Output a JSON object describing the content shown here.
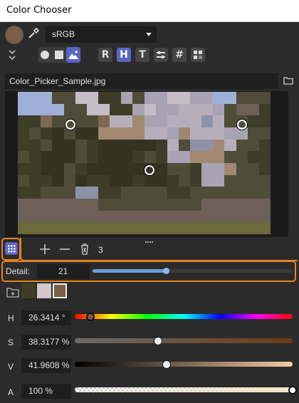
{
  "window": {
    "title": "Color Chooser"
  },
  "toolbar": {
    "color_space": "sRGB",
    "mode_buttons": [
      "circle",
      "square",
      "image"
    ],
    "tab_buttons": [
      "R",
      "H",
      "T",
      "⠒",
      "#",
      "▚"
    ],
    "active_tab": "H"
  },
  "file": {
    "name": "Color_Picker_Sample.jpg"
  },
  "palette_tools": {
    "count": "3"
  },
  "detail": {
    "label": "Detail:",
    "value": "21",
    "slider_fraction": 0.37
  },
  "swatches": [
    "#3f3d26",
    "#d3c7cc",
    "#7a5e47"
  ],
  "channels": {
    "h": {
      "label": "H",
      "value": "26.3414 °",
      "fraction": 0.073
    },
    "s": {
      "label": "S",
      "value": "38.3177 %",
      "fraction": 0.383
    },
    "v": {
      "label": "V",
      "value": "41.9608 %",
      "fraction": 0.42
    },
    "a": {
      "label": "A",
      "value": "100 %",
      "fraction": 1.0
    }
  },
  "colors": {
    "accent": "#5865c2",
    "highlight": "#e8821e",
    "current": "#7a5e47"
  }
}
